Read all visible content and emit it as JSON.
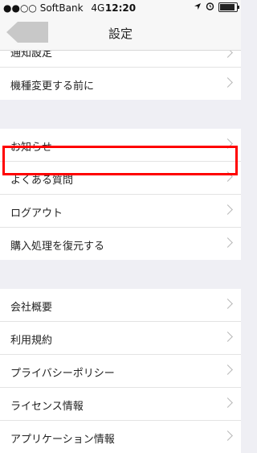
{
  "status": {
    "carrier": "●●○○ SoftBank",
    "network": "4G",
    "time": "12:20",
    "battery_level": 0.9
  },
  "nav": {
    "title": "設定"
  },
  "sections": [
    {
      "items": [
        {
          "label": "通知設定"
        },
        {
          "label": "機種変更する前に"
        }
      ]
    },
    {
      "items": [
        {
          "label": "お知らせ"
        },
        {
          "label": "よくある質問"
        },
        {
          "label": "ログアウト"
        },
        {
          "label": "購入処理を復元する"
        }
      ]
    },
    {
      "items": [
        {
          "label": "会社概要"
        },
        {
          "label": "利用規約"
        },
        {
          "label": "プライバシーポリシー"
        },
        {
          "label": "ライセンス情報"
        },
        {
          "label": "アプリケーション情報"
        }
      ]
    }
  ],
  "annotation": {
    "highlight_color": "#ff0000"
  }
}
